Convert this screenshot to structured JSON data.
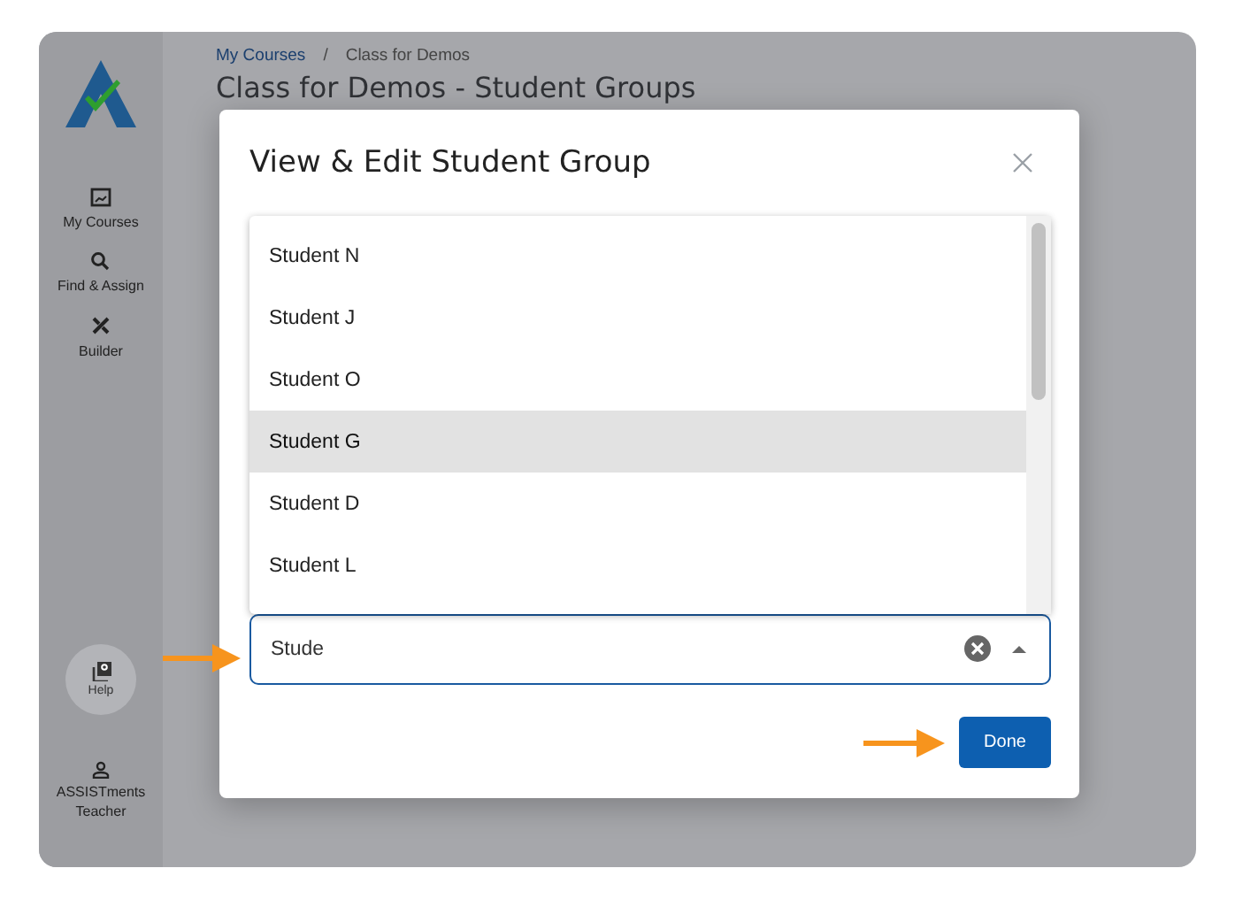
{
  "sidebar": {
    "nav_items": [
      {
        "label": "My Courses"
      },
      {
        "label": "Find & Assign"
      },
      {
        "label": "Builder"
      }
    ],
    "help": {
      "label": "Help"
    },
    "user": {
      "label": "ASSISTments Teacher"
    }
  },
  "breadcrumb": {
    "items": [
      "My Courses",
      "Class for Demos"
    ],
    "separator": "/"
  },
  "page_title": "Class for Demos - Student Groups",
  "dialog": {
    "title": "View & Edit Student Group",
    "options": [
      {
        "label": "Student N",
        "selected": false
      },
      {
        "label": "Student J",
        "selected": false
      },
      {
        "label": "Student O",
        "selected": false
      },
      {
        "label": "Student G",
        "selected": true
      },
      {
        "label": "Student D",
        "selected": false
      },
      {
        "label": "Student L",
        "selected": false
      }
    ],
    "field": {
      "value": "Stude"
    },
    "done_button": "Done"
  }
}
